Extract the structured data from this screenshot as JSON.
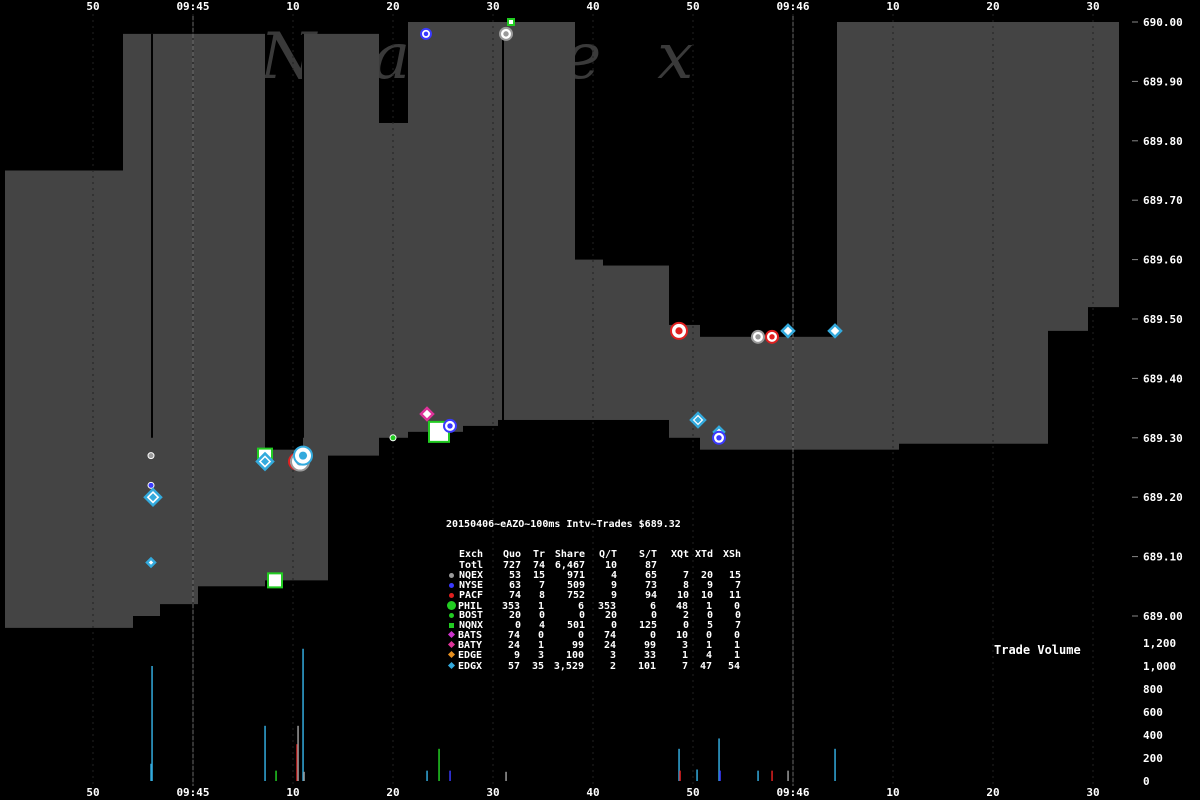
{
  "chart_data": [
    {
      "type": "area",
      "name": "nbbo-spread",
      "title": "20150406~eAZO~100ms Intv~Trades $689.32",
      "ylim": [
        688.97,
        690.0
      ],
      "y_ticks": [
        "689.00",
        "689.10",
        "689.20",
        "689.30",
        "689.40",
        "689.50",
        "689.60",
        "689.70",
        "689.80",
        "689.90",
        "690.00"
      ],
      "x_ticks": [
        "50",
        "09:45",
        "10",
        "20",
        "30",
        "40",
        "50",
        "09:46",
        "10",
        "20",
        "30"
      ],
      "x_tick_seconds": [
        -10,
        0,
        10,
        20,
        30,
        40,
        50,
        60,
        70,
        80,
        90
      ],
      "grid": "vertical at minute marks",
      "spread_segments": [
        {
          "t0": -18.8,
          "t1": -7.0,
          "bid": 688.98,
          "ask": 689.75
        },
        {
          "t0": -7.0,
          "t1": -6.0,
          "bid": 688.98,
          "ask": 689.98
        },
        {
          "t0": -6.0,
          "t1": -3.3,
          "bid": 689.0,
          "ask": 689.98
        },
        {
          "t0": -3.3,
          "t1": 0.5,
          "bid": 689.02,
          "ask": 689.98
        },
        {
          "t0": 0.5,
          "t1": 3.0,
          "bid": 689.05,
          "ask": 689.98
        },
        {
          "t0": 3.0,
          "t1": 7.2,
          "bid": 689.05,
          "ask": 689.98
        },
        {
          "t0": 7.2,
          "t1": 11.0,
          "bid": 689.06,
          "ask": 689.28
        },
        {
          "t0": 11.0,
          "t1": 13.5,
          "bid": 689.06,
          "ask": 689.98
        },
        {
          "t0": 13.5,
          "t1": 18.6,
          "bid": 689.27,
          "ask": 689.98
        },
        {
          "t0": 18.6,
          "t1": 21.5,
          "bid": 689.3,
          "ask": 689.83
        },
        {
          "t0": 21.5,
          "t1": 27.0,
          "bid": 689.31,
          "ask": 690.0
        },
        {
          "t0": 27.0,
          "t1": 30.5,
          "bid": 689.32,
          "ask": 690.0
        },
        {
          "t0": 30.5,
          "t1": 38.2,
          "bid": 689.33,
          "ask": 690.0
        },
        {
          "t0": 38.2,
          "t1": 41.0,
          "bid": 689.33,
          "ask": 689.6
        },
        {
          "t0": 41.0,
          "t1": 47.6,
          "bid": 689.33,
          "ask": 689.59
        },
        {
          "t0": 47.6,
          "t1": 50.7,
          "bid": 689.3,
          "ask": 689.49
        },
        {
          "t0": 50.7,
          "t1": 54.0,
          "bid": 689.28,
          "ask": 689.47
        },
        {
          "t0": 54.0,
          "t1": 64.4,
          "bid": 689.28,
          "ask": 689.47
        },
        {
          "t0": 64.4,
          "t1": 70.6,
          "bid": 689.28,
          "ask": 690.0
        },
        {
          "t0": 70.6,
          "t1": 82.8,
          "bid": 689.29,
          "ask": 690.0
        },
        {
          "t0": 82.8,
          "t1": 85.5,
          "bid": 689.29,
          "ask": 690.0
        },
        {
          "t0": 85.5,
          "t1": 89.5,
          "bid": 689.48,
          "ask": 690.0
        },
        {
          "t0": 89.5,
          "t1": 92.6,
          "bid": 689.52,
          "ask": 690.0
        }
      ],
      "trades": [
        {
          "t": -4.2,
          "price": 689.27,
          "exch": "NQEX",
          "shape": "dot",
          "size": 3
        },
        {
          "t": -4.2,
          "price": 689.22,
          "exch": "NYSE",
          "shape": "dot",
          "size": 3
        },
        {
          "t": -4.0,
          "price": 689.2,
          "exch": "EDGX",
          "shape": "diamond",
          "size": 8
        },
        {
          "t": -4.2,
          "price": 689.09,
          "exch": "EDGX",
          "shape": "diamond",
          "size": 4
        },
        {
          "t": 7.2,
          "price": 689.27,
          "exch": "PHIL",
          "shape": "square",
          "size": 7
        },
        {
          "t": 7.2,
          "price": 689.26,
          "exch": "EDGX",
          "shape": "diamond",
          "size": 8
        },
        {
          "t": 8.2,
          "price": 689.06,
          "exch": "PHIL",
          "shape": "square",
          "size": 7
        },
        {
          "t": 10.4,
          "price": 689.26,
          "exch": "PACF",
          "shape": "dot",
          "size": 8
        },
        {
          "t": 10.7,
          "price": 689.26,
          "exch": "NQEX",
          "shape": "dot",
          "size": 9
        },
        {
          "t": 11.0,
          "price": 689.27,
          "exch": "EDGX",
          "shape": "dot",
          "size": 9
        },
        {
          "t": 20.0,
          "price": 689.3,
          "exch": "BOST",
          "shape": "dot",
          "size": 3
        },
        {
          "t": 23.4,
          "price": 689.34,
          "exch": "BATY",
          "shape": "diamond",
          "size": 6
        },
        {
          "t": 23.3,
          "price": 689.98,
          "exch": "NYSE",
          "shape": "dot",
          "size": 5
        },
        {
          "t": 24.6,
          "price": 689.31,
          "exch": "PHIL",
          "shape": "square",
          "size": 10
        },
        {
          "t": 25.7,
          "price": 689.32,
          "exch": "NYSE",
          "shape": "dot",
          "size": 6
        },
        {
          "t": 31.3,
          "price": 689.98,
          "exch": "NQEX",
          "shape": "dot",
          "size": 6
        },
        {
          "t": 31.8,
          "price": 690.0,
          "exch": "NQNX",
          "shape": "square",
          "size": 3
        },
        {
          "t": 48.6,
          "price": 689.48,
          "exch": "PACF",
          "shape": "dot",
          "size": 8
        },
        {
          "t": 50.5,
          "price": 689.33,
          "exch": "EDGX",
          "shape": "diamond",
          "size": 7
        },
        {
          "t": 52.6,
          "price": 689.31,
          "exch": "EDGX",
          "shape": "diamond",
          "size": 5
        },
        {
          "t": 52.6,
          "price": 689.3,
          "exch": "NYSE",
          "shape": "dot",
          "size": 6
        },
        {
          "t": 56.5,
          "price": 689.47,
          "exch": "NQEX",
          "shape": "dot",
          "size": 6
        },
        {
          "t": 57.9,
          "price": 689.47,
          "exch": "PACF",
          "shape": "dot",
          "size": 6
        },
        {
          "t": 59.5,
          "price": 689.48,
          "exch": "EDGX",
          "shape": "diamond",
          "size": 6
        },
        {
          "t": 64.2,
          "price": 689.48,
          "exch": "EDGX",
          "shape": "diamond",
          "size": 6
        }
      ],
      "exchange_colors": {
        "NQEX": "#9a9a9a",
        "NYSE": "#3a3aff",
        "PACF": "#e02020",
        "PHIL": "#22cc22",
        "BOST": "#22cc22",
        "NQNX": "#22cc22",
        "BATS": "#cc33cc",
        "BATY": "#dd3399",
        "EDGE": "#e69020",
        "EDGX": "#33aadd"
      },
      "fill_color": "#444444"
    },
    {
      "type": "bar",
      "name": "trade-volume",
      "title": "Trade Volume",
      "ylim": [
        0,
        1200
      ],
      "y_ticks": [
        "0",
        "200",
        "400",
        "600",
        "800",
        "1,000",
        "1,200"
      ],
      "bars": [
        {
          "t": -4.1,
          "value": 1000,
          "exch": "EDGX"
        },
        {
          "t": -4.2,
          "value": 150,
          "exch": "EDGX"
        },
        {
          "t": 7.2,
          "value": 480,
          "exch": "EDGX"
        },
        {
          "t": 8.3,
          "value": 90,
          "exch": "PHIL"
        },
        {
          "t": 10.4,
          "value": 320,
          "exch": "PACF"
        },
        {
          "t": 10.5,
          "value": 480,
          "exch": "NQEX"
        },
        {
          "t": 11.0,
          "value": 1150,
          "exch": "EDGX"
        },
        {
          "t": 11.1,
          "value": 80,
          "exch": "NQEX"
        },
        {
          "t": 23.4,
          "value": 90,
          "exch": "EDGX"
        },
        {
          "t": 24.6,
          "value": 280,
          "exch": "PHIL"
        },
        {
          "t": 25.7,
          "value": 90,
          "exch": "NYSE"
        },
        {
          "t": 31.3,
          "value": 80,
          "exch": "NQEX"
        },
        {
          "t": 48.6,
          "value": 280,
          "exch": "EDGX"
        },
        {
          "t": 48.7,
          "value": 90,
          "exch": "PACF"
        },
        {
          "t": 50.4,
          "value": 100,
          "exch": "EDGX"
        },
        {
          "t": 52.6,
          "value": 370,
          "exch": "EDGX"
        },
        {
          "t": 52.7,
          "value": 90,
          "exch": "NYSE"
        },
        {
          "t": 56.5,
          "value": 90,
          "exch": "EDGX"
        },
        {
          "t": 57.9,
          "value": 90,
          "exch": "PACF"
        },
        {
          "t": 59.5,
          "value": 90,
          "exch": "NQEX"
        },
        {
          "t": 64.2,
          "value": 280,
          "exch": "EDGX"
        }
      ]
    }
  ],
  "stats_table": {
    "title": "20150406~eAZO~100ms Intv~Trades $689.32",
    "headers": [
      "Exch",
      "Quo",
      "Tr",
      "Share",
      "Q/T",
      "S/T",
      "XQt",
      "XTd",
      "XSh"
    ],
    "rows": [
      {
        "marker": "none",
        "color": "#ffffff",
        "cells": [
          "Totl",
          "727",
          "74",
          "6,467",
          "10",
          "87",
          "",
          "",
          ""
        ]
      },
      {
        "marker": "dot",
        "color": "#9a9a9a",
        "cells": [
          "NQEX",
          "53",
          "15",
          "971",
          "4",
          "65",
          "7",
          "20",
          "15"
        ]
      },
      {
        "marker": "dot",
        "color": "#3a3aff",
        "cells": [
          "NYSE",
          "63",
          "7",
          "509",
          "9",
          "73",
          "8",
          "9",
          "7"
        ]
      },
      {
        "marker": "dot",
        "color": "#e02020",
        "cells": [
          "PACF",
          "74",
          "8",
          "752",
          "9",
          "94",
          "10",
          "10",
          "11"
        ]
      },
      {
        "marker": "bigdot",
        "color": "#22cc22",
        "cells": [
          "PHIL",
          "353",
          "1",
          "6",
          "353",
          "6",
          "48",
          "1",
          "0"
        ]
      },
      {
        "marker": "dot",
        "color": "#22cc22",
        "cells": [
          "BOST",
          "20",
          "0",
          "0",
          "20",
          "0",
          "2",
          "0",
          "0"
        ]
      },
      {
        "marker": "square",
        "color": "#22cc22",
        "cells": [
          "NQNX",
          "0",
          "4",
          "501",
          "0",
          "125",
          "0",
          "5",
          "7"
        ]
      },
      {
        "marker": "diamond",
        "color": "#cc33cc",
        "cells": [
          "BATS",
          "74",
          "0",
          "0",
          "74",
          "0",
          "10",
          "0",
          "0"
        ]
      },
      {
        "marker": "diamond",
        "color": "#dd3399",
        "cells": [
          "BATY",
          "24",
          "1",
          "99",
          "24",
          "99",
          "3",
          "1",
          "1"
        ]
      },
      {
        "marker": "diamond",
        "color": "#e69020",
        "cells": [
          "EDGE",
          "9",
          "3",
          "100",
          "3",
          "33",
          "1",
          "4",
          "1"
        ]
      },
      {
        "marker": "diamond",
        "color": "#33aadd",
        "cells": [
          "EDGX",
          "57",
          "35",
          "3,529",
          "2",
          "101",
          "7",
          "47",
          "54"
        ]
      }
    ]
  },
  "volume_label": "Trade Volume",
  "watermark": "Nanex"
}
